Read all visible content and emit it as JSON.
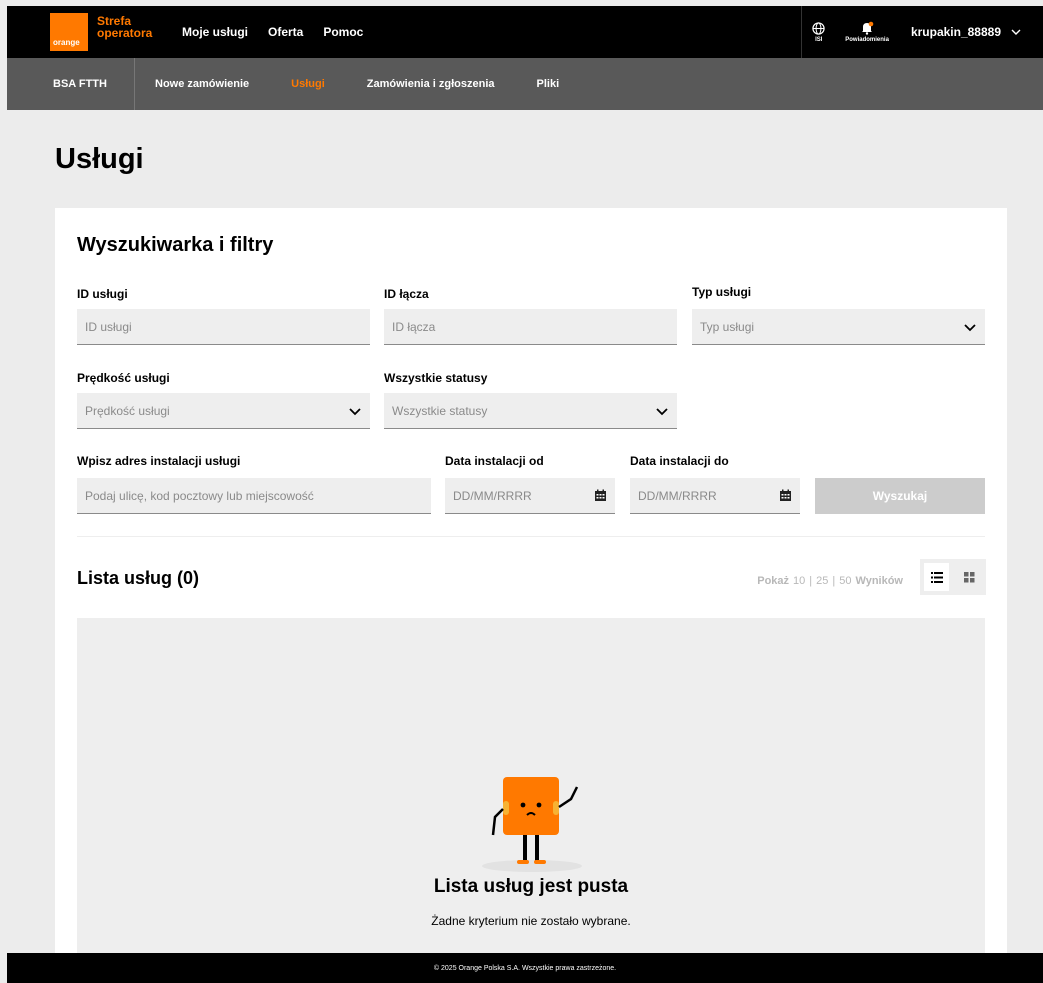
{
  "brand": {
    "logo_text": "orange",
    "name_line1": "Strefa",
    "name_line2": "operatora"
  },
  "topnav": [
    "Moje usługi",
    "Oferta",
    "Pomoc"
  ],
  "topright": {
    "isi": "ISI",
    "notifications": "Powiadomienia",
    "username": "krupakin_88889"
  },
  "subnav": {
    "first": "BSA FTTH",
    "items": [
      "Nowe zamówienie",
      "Usługi",
      "Zamówienia i zgłoszenia",
      "Pliki"
    ],
    "active_index": 1
  },
  "page": {
    "title": "Usługi"
  },
  "filters": {
    "title": "Wyszukiwarka i filtry",
    "service_id": {
      "label": "ID usługi",
      "placeholder": "ID usługi"
    },
    "link_id": {
      "label": "ID łącza",
      "placeholder": "ID łącza"
    },
    "service_type": {
      "label": "Typ usługi",
      "placeholder": "Typ usługi"
    },
    "speed": {
      "label": "Prędkość usługi",
      "placeholder": "Prędkość usługi"
    },
    "status": {
      "label": "Wszystkie statusy",
      "placeholder": "Wszystkie statusy"
    },
    "address": {
      "label": "Wpisz adres instalacji usługi",
      "placeholder": "Podaj ulicę, kod pocztowy lub miejscowość"
    },
    "date_from": {
      "label": "Data instalacji od",
      "placeholder": "DD/MM/RRRR"
    },
    "date_to": {
      "label": "Data instalacji do",
      "placeholder": "DD/MM/RRRR"
    },
    "search_button": "Wyszukaj"
  },
  "list": {
    "title": "Lista usług (0)",
    "pager": {
      "show": "Pokaż",
      "options": [
        "10",
        "25",
        "50"
      ],
      "results": "Wyników"
    },
    "empty_title": "Lista usług jest pusta",
    "empty_subtitle": "Żadne kryterium nie zostało wybrane."
  },
  "footer": "© 2025 Orange Polska S.A. Wszystkie prawa zastrzeżone.",
  "colors": {
    "accent": "#ff7900",
    "topbar": "#000000",
    "subnav": "#595959"
  }
}
